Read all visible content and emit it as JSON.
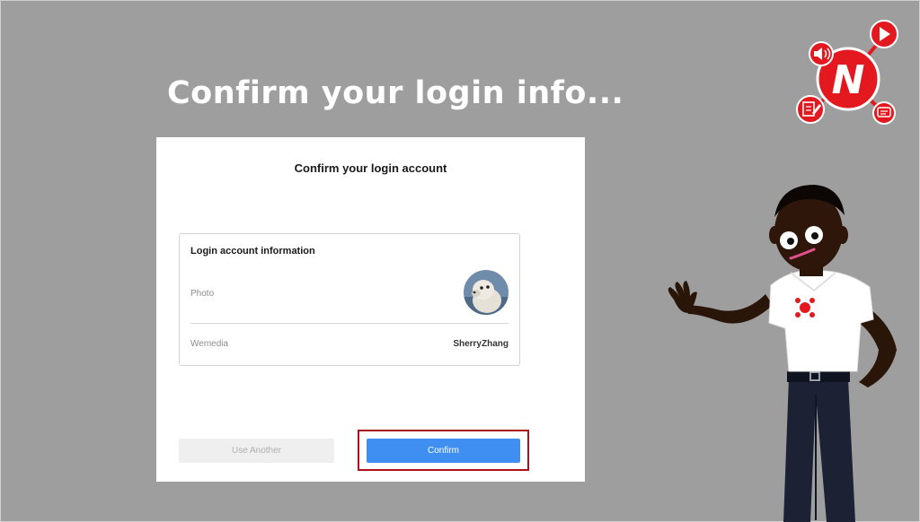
{
  "slide": {
    "headline": "Confirm your login info..."
  },
  "dialog": {
    "title": "Confirm your login account",
    "card": {
      "title": "Login account information",
      "photo_label": "Photo",
      "wemedia_label": "Wemedia",
      "wemedia_value": "SherryZhang"
    },
    "buttons": {
      "use_another": "Use Another",
      "confirm": "Confirm"
    }
  },
  "logo": {
    "letter": "N",
    "icons": [
      "speaker-icon",
      "play-icon",
      "edit-icon",
      "chat-icon"
    ]
  },
  "colors": {
    "background": "#9e9e9e",
    "primary_button": "#3f8ff2",
    "highlight": "#a8141a",
    "logo_red": "#e3191f"
  }
}
